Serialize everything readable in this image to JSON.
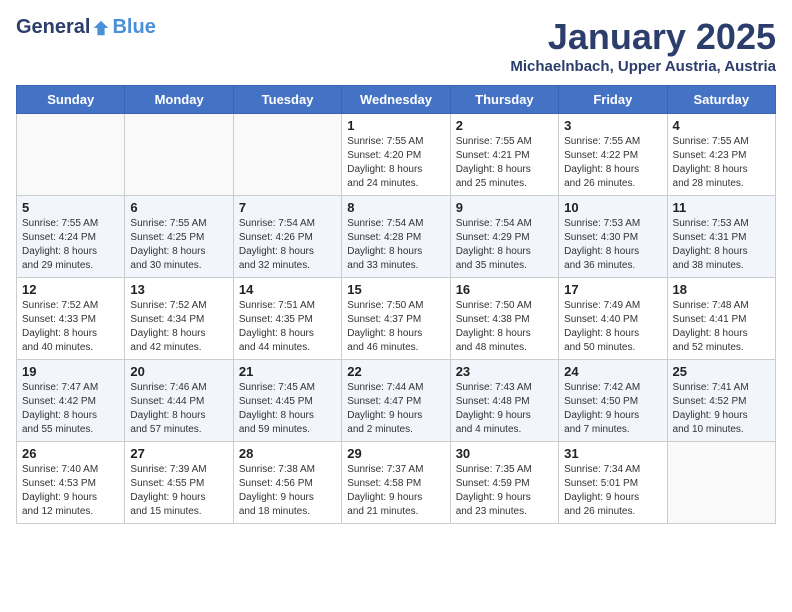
{
  "header": {
    "logo_general": "General",
    "logo_blue": "Blue",
    "month_title": "January 2025",
    "location": "Michaelnbach, Upper Austria, Austria"
  },
  "days_of_week": [
    "Sunday",
    "Monday",
    "Tuesday",
    "Wednesday",
    "Thursday",
    "Friday",
    "Saturday"
  ],
  "weeks": [
    [
      {
        "day": "",
        "info": ""
      },
      {
        "day": "",
        "info": ""
      },
      {
        "day": "",
        "info": ""
      },
      {
        "day": "1",
        "info": "Sunrise: 7:55 AM\nSunset: 4:20 PM\nDaylight: 8 hours\nand 24 minutes."
      },
      {
        "day": "2",
        "info": "Sunrise: 7:55 AM\nSunset: 4:21 PM\nDaylight: 8 hours\nand 25 minutes."
      },
      {
        "day": "3",
        "info": "Sunrise: 7:55 AM\nSunset: 4:22 PM\nDaylight: 8 hours\nand 26 minutes."
      },
      {
        "day": "4",
        "info": "Sunrise: 7:55 AM\nSunset: 4:23 PM\nDaylight: 8 hours\nand 28 minutes."
      }
    ],
    [
      {
        "day": "5",
        "info": "Sunrise: 7:55 AM\nSunset: 4:24 PM\nDaylight: 8 hours\nand 29 minutes."
      },
      {
        "day": "6",
        "info": "Sunrise: 7:55 AM\nSunset: 4:25 PM\nDaylight: 8 hours\nand 30 minutes."
      },
      {
        "day": "7",
        "info": "Sunrise: 7:54 AM\nSunset: 4:26 PM\nDaylight: 8 hours\nand 32 minutes."
      },
      {
        "day": "8",
        "info": "Sunrise: 7:54 AM\nSunset: 4:28 PM\nDaylight: 8 hours\nand 33 minutes."
      },
      {
        "day": "9",
        "info": "Sunrise: 7:54 AM\nSunset: 4:29 PM\nDaylight: 8 hours\nand 35 minutes."
      },
      {
        "day": "10",
        "info": "Sunrise: 7:53 AM\nSunset: 4:30 PM\nDaylight: 8 hours\nand 36 minutes."
      },
      {
        "day": "11",
        "info": "Sunrise: 7:53 AM\nSunset: 4:31 PM\nDaylight: 8 hours\nand 38 minutes."
      }
    ],
    [
      {
        "day": "12",
        "info": "Sunrise: 7:52 AM\nSunset: 4:33 PM\nDaylight: 8 hours\nand 40 minutes."
      },
      {
        "day": "13",
        "info": "Sunrise: 7:52 AM\nSunset: 4:34 PM\nDaylight: 8 hours\nand 42 minutes."
      },
      {
        "day": "14",
        "info": "Sunrise: 7:51 AM\nSunset: 4:35 PM\nDaylight: 8 hours\nand 44 minutes."
      },
      {
        "day": "15",
        "info": "Sunrise: 7:50 AM\nSunset: 4:37 PM\nDaylight: 8 hours\nand 46 minutes."
      },
      {
        "day": "16",
        "info": "Sunrise: 7:50 AM\nSunset: 4:38 PM\nDaylight: 8 hours\nand 48 minutes."
      },
      {
        "day": "17",
        "info": "Sunrise: 7:49 AM\nSunset: 4:40 PM\nDaylight: 8 hours\nand 50 minutes."
      },
      {
        "day": "18",
        "info": "Sunrise: 7:48 AM\nSunset: 4:41 PM\nDaylight: 8 hours\nand 52 minutes."
      }
    ],
    [
      {
        "day": "19",
        "info": "Sunrise: 7:47 AM\nSunset: 4:42 PM\nDaylight: 8 hours\nand 55 minutes."
      },
      {
        "day": "20",
        "info": "Sunrise: 7:46 AM\nSunset: 4:44 PM\nDaylight: 8 hours\nand 57 minutes."
      },
      {
        "day": "21",
        "info": "Sunrise: 7:45 AM\nSunset: 4:45 PM\nDaylight: 8 hours\nand 59 minutes."
      },
      {
        "day": "22",
        "info": "Sunrise: 7:44 AM\nSunset: 4:47 PM\nDaylight: 9 hours\nand 2 minutes."
      },
      {
        "day": "23",
        "info": "Sunrise: 7:43 AM\nSunset: 4:48 PM\nDaylight: 9 hours\nand 4 minutes."
      },
      {
        "day": "24",
        "info": "Sunrise: 7:42 AM\nSunset: 4:50 PM\nDaylight: 9 hours\nand 7 minutes."
      },
      {
        "day": "25",
        "info": "Sunrise: 7:41 AM\nSunset: 4:52 PM\nDaylight: 9 hours\nand 10 minutes."
      }
    ],
    [
      {
        "day": "26",
        "info": "Sunrise: 7:40 AM\nSunset: 4:53 PM\nDaylight: 9 hours\nand 12 minutes."
      },
      {
        "day": "27",
        "info": "Sunrise: 7:39 AM\nSunset: 4:55 PM\nDaylight: 9 hours\nand 15 minutes."
      },
      {
        "day": "28",
        "info": "Sunrise: 7:38 AM\nSunset: 4:56 PM\nDaylight: 9 hours\nand 18 minutes."
      },
      {
        "day": "29",
        "info": "Sunrise: 7:37 AM\nSunset: 4:58 PM\nDaylight: 9 hours\nand 21 minutes."
      },
      {
        "day": "30",
        "info": "Sunrise: 7:35 AM\nSunset: 4:59 PM\nDaylight: 9 hours\nand 23 minutes."
      },
      {
        "day": "31",
        "info": "Sunrise: 7:34 AM\nSunset: 5:01 PM\nDaylight: 9 hours\nand 26 minutes."
      },
      {
        "day": "",
        "info": ""
      }
    ]
  ]
}
